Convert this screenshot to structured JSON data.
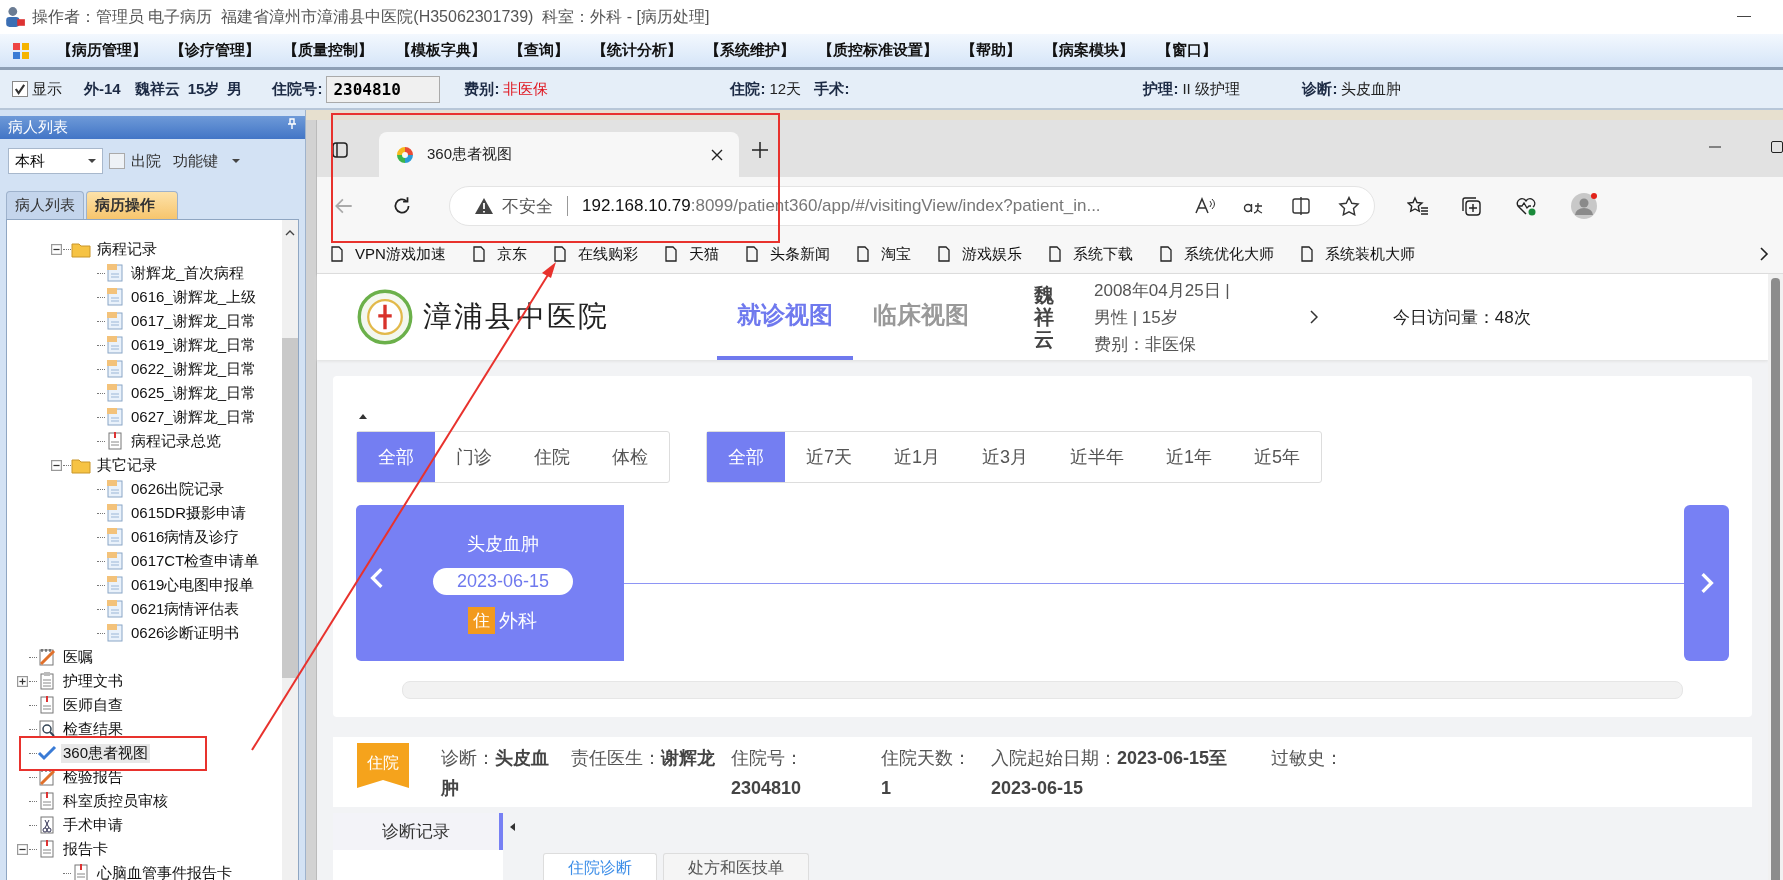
{
  "window": {
    "title": "操作者：管理员 电子病历  福建省漳州市漳浦县中医院(H35062301739)  科室：外科 - [病历处理]"
  },
  "menu": [
    "【病历管理】",
    "【诊疗管理】",
    "【质量控制】",
    "【模板字典】",
    "【查询】",
    "【统计分析】",
    "【系统维护】",
    "【质控标准设置】",
    "【帮助】",
    "【病案模块】",
    "【窗口】"
  ],
  "patient_bar": {
    "show": {
      "label": "显示",
      "checked": true
    },
    "ward": "外-14",
    "name": "魏祥云",
    "age": "15岁",
    "sex": "男",
    "fields": [
      {
        "label": "住院号:",
        "value": "2304810",
        "kind": "input"
      },
      {
        "label": "费别:",
        "value": "非医保",
        "kind": "alert"
      },
      {
        "label": "住院:",
        "value": "12天",
        "kind": "plain"
      },
      {
        "label": "手术:"
      },
      {
        "label": "护理:",
        "value": "II 级护理",
        "kind": "plain"
      },
      {
        "label": "诊断:",
        "value": "头皮血肿",
        "kind": "plain"
      }
    ]
  },
  "patient_panel": {
    "title": "病人列表",
    "scope": "本科",
    "discharged": {
      "label": "出院",
      "checked": false
    },
    "function_key": "功能键",
    "tabs": [
      {
        "label": "病人列表",
        "selected": false
      },
      {
        "label": "病历操作",
        "selected": true
      }
    ],
    "tree": [
      {
        "children": [
          {
            "label": "病程记录",
            "kind": "folder",
            "expanded": true,
            "selected": false,
            "children": [
              {
                "label": "谢辉龙_首次病程",
                "kind": "doc",
                "selected": false
              },
              {
                "label": "0616_谢辉龙_上级",
                "kind": "doc",
                "selected": false
              },
              {
                "label": "0617_谢辉龙_日常",
                "kind": "doc",
                "selected": false
              },
              {
                "label": "0619_谢辉龙_日常",
                "kind": "doc",
                "selected": false
              },
              {
                "label": "0622_谢辉龙_日常",
                "kind": "doc",
                "selected": false
              },
              {
                "label": "0625_谢辉龙_日常",
                "kind": "doc",
                "selected": false
              },
              {
                "label": "0627_谢辉龙_日常",
                "kind": "doc",
                "selected": false
              },
              {
                "label": "病程记录总览",
                "kind": "note",
                "selected": false
              }
            ]
          },
          {
            "label": "其它记录",
            "kind": "folder",
            "expanded": true,
            "selected": false,
            "children": [
              {
                "label": "0626出院记录",
                "kind": "doc",
                "selected": false
              },
              {
                "label": "0615DR摄影申请",
                "kind": "doc",
                "selected": false
              },
              {
                "label": "0616病情及诊疗",
                "kind": "doc",
                "selected": false
              },
              {
                "label": "0617CT检查申请单",
                "kind": "doc",
                "selected": false
              },
              {
                "label": "0619心电图申报单",
                "kind": "doc",
                "selected": false
              },
              {
                "label": "0621病情评估表",
                "kind": "doc",
                "selected": false
              },
              {
                "label": "0626诊断证明书",
                "kind": "doc",
                "selected": false
              }
            ]
          }
        ]
      },
      {
        "label": "医嘱",
        "kind": "pencil",
        "selected": false
      },
      {
        "label": "护理文书",
        "kind": "clipboard",
        "expanded": false,
        "selected": false
      },
      {
        "label": "医师自查",
        "kind": "note",
        "selected": false
      },
      {
        "label": "检查结果",
        "kind": "search",
        "selected": false
      },
      {
        "label": "360患者视图",
        "kind": "check",
        "selected": true
      },
      {
        "label": "检验报告",
        "kind": "pencil",
        "selected": false
      },
      {
        "label": "科室质控员审核",
        "kind": "note",
        "selected": false
      },
      {
        "label": "手术申请",
        "kind": "scissors",
        "selected": false
      },
      {
        "label": "报告卡",
        "kind": "note",
        "expanded": true,
        "selected": false,
        "children": [
          {
            "label": "心脑血管事件报告卡",
            "kind": "note",
            "selected": false
          }
        ]
      }
    ]
  },
  "browser": {
    "tab_title": "360患者视图",
    "security": "不安全",
    "host": "192.168.10.79",
    "path": ":8099/patient360/app/#/visitingView/index?patient_in...",
    "bookmarks": [
      "VPN游戏加速",
      "京东",
      "在线购彩",
      "天猫",
      "头条新闻",
      "淘宝",
      "游戏娱乐",
      "系统下载",
      "系统优化大师",
      "系统装机大师"
    ]
  },
  "page": {
    "hospital": "漳浦县中医院",
    "nav": [
      {
        "label": "就诊视图",
        "selected": true
      },
      {
        "label": "临床视图",
        "selected": false
      }
    ],
    "patient": {
      "name": "魏祥云",
      "lines": [
        "2008年04月25日 |",
        "男性 | 15岁",
        "费别：非医保"
      ]
    },
    "visits": "今日访问量：48次",
    "type_filters": [
      {
        "label": "全部",
        "selected": true
      },
      {
        "label": "门诊",
        "selected": false
      },
      {
        "label": "住院",
        "selected": false
      },
      {
        "label": "体检",
        "selected": false
      }
    ],
    "time_filters": [
      {
        "label": "全部",
        "selected": true
      },
      {
        "label": "近7天",
        "selected": false
      },
      {
        "label": "近1月",
        "selected": false
      },
      {
        "label": "近3月",
        "selected": false
      },
      {
        "label": "近半年",
        "selected": false
      },
      {
        "label": "近1年",
        "selected": false
      },
      {
        "label": "近5年",
        "selected": false
      }
    ],
    "timeline": [
      {
        "diagnosis": "头皮血肿",
        "date": "2023-06-15",
        "badge": "住",
        "department": "外科"
      }
    ],
    "summary": {
      "badge": "住院",
      "fields": [
        {
          "text": "诊断：**头皮血肿**"
        },
        {
          "text": "责任医生：**谢辉龙**"
        },
        {
          "text": "住院号：**2304810**"
        },
        {
          "text": "住院天数：**1**"
        },
        {
          "text": "入院起始日期：**2023-06-15至2023-06-15**"
        },
        {
          "text": "过敏史："
        }
      ]
    },
    "side_tabs": [
      {
        "label": "诊断记录",
        "selected": true
      }
    ],
    "detail_tabs": [
      {
        "label": "住院诊断",
        "selected": true
      },
      {
        "label": "处方和医技单",
        "selected": false
      }
    ]
  }
}
